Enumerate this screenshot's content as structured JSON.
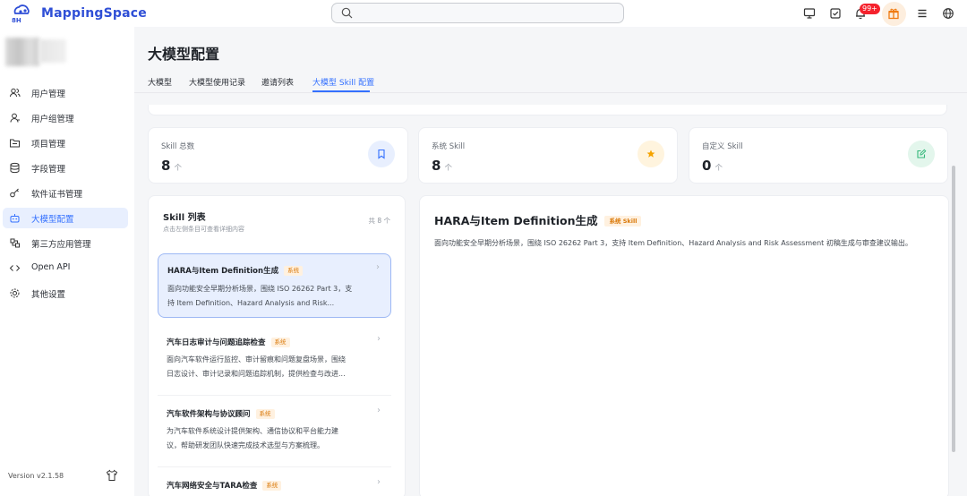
{
  "header": {
    "logo_badge": "8H",
    "app_name": "MappingSpace",
    "search_placeholder": "",
    "notification_badge": "99+",
    "icons": [
      "monitor-icon",
      "checkbox-icon",
      "bell-icon",
      "gift-icon",
      "menu-icon",
      "globe-icon"
    ]
  },
  "sidebar": {
    "items": [
      {
        "label": "用户管理",
        "icon": "users-icon",
        "active": false
      },
      {
        "label": "用户组管理",
        "icon": "user-group-icon",
        "active": false
      },
      {
        "label": "项目管理",
        "icon": "folder-icon",
        "active": false
      },
      {
        "label": "字段管理",
        "icon": "database-icon",
        "active": false
      },
      {
        "label": "软件证书管理",
        "icon": "key-icon",
        "active": false
      },
      {
        "label": "大模型配置",
        "icon": "robot-icon",
        "active": true
      },
      {
        "label": "第三方应用管理",
        "icon": "apps-icon",
        "active": false
      },
      {
        "label": "Open API",
        "icon": "code-icon",
        "active": false
      },
      {
        "label": "其他设置",
        "icon": "settings-icon",
        "active": false
      }
    ],
    "version": "Version v2.1.58"
  },
  "main": {
    "title": "大模型配置",
    "tabs": [
      {
        "label": "大模型",
        "active": false
      },
      {
        "label": "大模型使用记录",
        "active": false
      },
      {
        "label": "邀请列表",
        "active": false
      },
      {
        "label": "大模型 Skill 配置",
        "active": true
      }
    ],
    "stats": [
      {
        "label": "Skill 总数",
        "value": "8",
        "unit": "个",
        "icon": "bookmark-icon",
        "color": "#3370ff",
        "bg": "#e8effe"
      },
      {
        "label": "系统 Skill",
        "value": "8",
        "unit": "个",
        "icon": "star-icon",
        "color": "#f5a300",
        "bg": "#fff4de"
      },
      {
        "label": "自定义 Skill",
        "value": "0",
        "unit": "个",
        "icon": "edit-icon",
        "color": "#34b87a",
        "bg": "#e3f6ec"
      }
    ],
    "skill_list": {
      "title": "Skill 列表",
      "subtitle": "点击左侧条目可查看详细内容",
      "count": "共 8 个",
      "items": [
        {
          "title": "HARA与Item Definition生成",
          "tag": "系统",
          "desc_line1": "面向功能安全早期分析场景，围绕 ISO 26262 Part 3，支",
          "desc_line2": "持 Item Definition、Hazard Analysis and Risk...",
          "selected": true
        },
        {
          "title": "汽车日志审计与问题追踪检查",
          "tag": "系统",
          "desc_line1": "面向汽车软件运行监控、审计留痕和问题复盘场景，围绕",
          "desc_line2": "日志设计、审计记录和问题追踪机制，提供检查与改进...",
          "selected": false
        },
        {
          "title": "汽车软件架构与协议顾问",
          "tag": "系统",
          "desc_line1": "为汽车软件系统设计提供架构、通信协议和平台能力建",
          "desc_line2": "议，帮助研发团队快速完成技术选型与方案梳理。",
          "selected": false
        },
        {
          "title": "汽车网络安全与TARA检查",
          "tag": "系统",
          "desc_line1": "",
          "desc_line2": "",
          "selected": false
        }
      ]
    },
    "detail": {
      "title": "HARA与Item Definition生成",
      "tag": "系统 Skill",
      "desc": "面向功能安全早期分析场景，围绕 ISO 26262 Part 3，支持 Item Definition、Hazard Analysis and Risk Assessment 初稿生成与审查建议输出。"
    }
  }
}
